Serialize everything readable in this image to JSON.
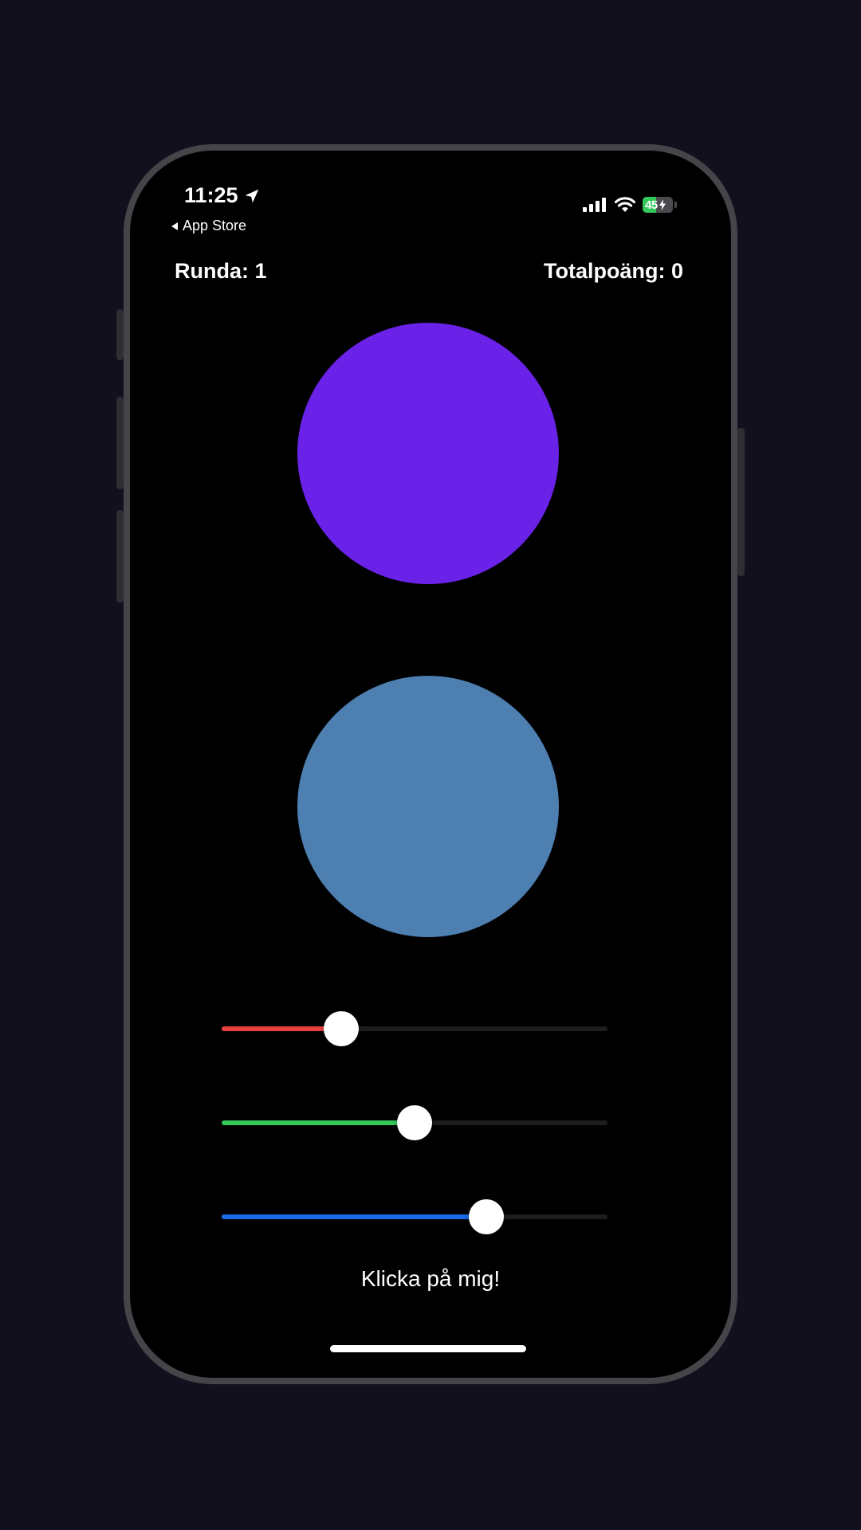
{
  "status_bar": {
    "time": "11:25",
    "location_icon": "location-arrow-icon",
    "back_label": "App Store",
    "signal_icon": "cellular-signal-icon",
    "wifi_icon": "wifi-icon",
    "battery_level": "45",
    "battery_fraction": 0.45,
    "battery_color": "#34c759"
  },
  "header": {
    "round_label": "Runda: 1",
    "score_label": "Totalpoäng: 0"
  },
  "circles": {
    "target_color": "#6a21e8",
    "guess_color": "#4d7fb1"
  },
  "sliders": [
    {
      "name": "red",
      "color": "#e8413e",
      "value": 0.31
    },
    {
      "name": "green",
      "color": "#34c759",
      "value": 0.5
    },
    {
      "name": "blue",
      "color": "#1a6be8",
      "value": 0.685
    }
  ],
  "action": {
    "label": "Klicka på mig!"
  }
}
